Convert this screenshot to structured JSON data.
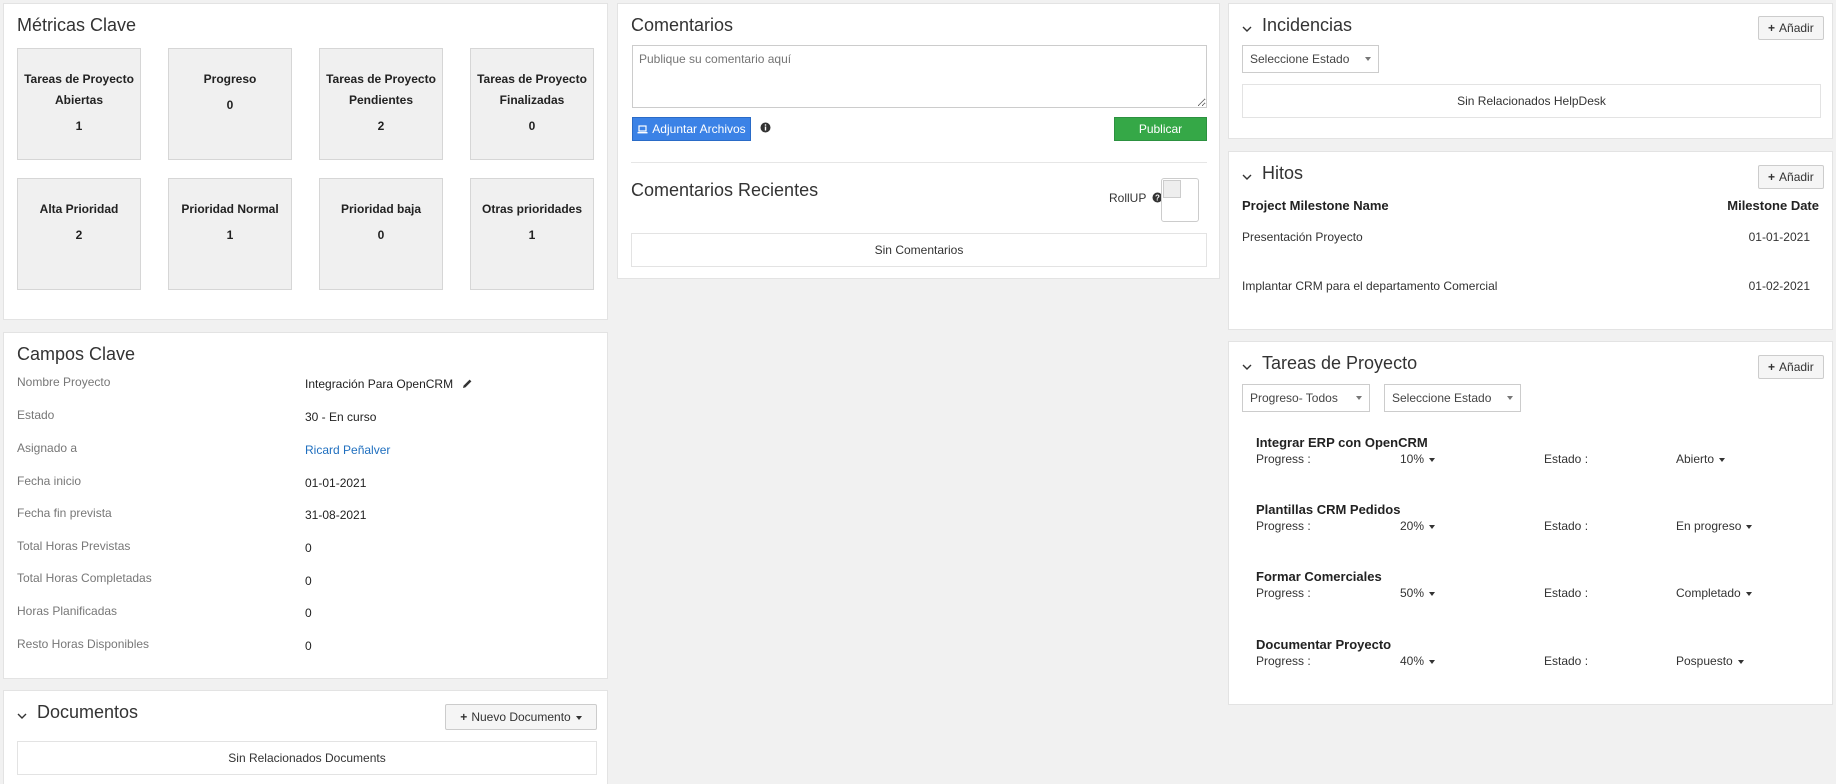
{
  "metrics": {
    "title": "Métricas Clave",
    "cards": [
      {
        "label": "Tareas de Proyecto Abiertas",
        "value": "1"
      },
      {
        "label": "Progreso",
        "value": "0"
      },
      {
        "label": "Tareas de Proyecto Pendientes",
        "value": "2"
      },
      {
        "label": "Tareas de Proyecto Finalizadas",
        "value": "0"
      },
      {
        "label": "Alta Prioridad",
        "value": "2"
      },
      {
        "label": "Prioridad Normal",
        "value": "1"
      },
      {
        "label": "Prioridad baja",
        "value": "0"
      },
      {
        "label": "Otras prioridades",
        "value": "1"
      }
    ]
  },
  "key_fields": {
    "title": "Campos Clave",
    "rows": [
      {
        "label": "Nombre Proyecto",
        "value": "Integración Para OpenCRM"
      },
      {
        "label": "Estado",
        "value": "30 - En curso"
      },
      {
        "label": "Asignado a",
        "value": "Ricard Peñalver"
      },
      {
        "label": "Fecha inicio",
        "value": "01-01-2021"
      },
      {
        "label": "Fecha fin prevista",
        "value": "31-08-2021"
      },
      {
        "label": "Total Horas Previstas",
        "value": "0"
      },
      {
        "label": "Total Horas Completadas",
        "value": "0"
      },
      {
        "label": "Horas Planificadas",
        "value": "0"
      },
      {
        "label": "Resto Horas Disponibles",
        "value": "0"
      }
    ]
  },
  "documents": {
    "title": "Documentos",
    "new_button": "Nuevo Documento",
    "empty": "Sin Relacionados Documents"
  },
  "comments": {
    "title": "Comentarios",
    "placeholder": "Publique su comentario aquí",
    "attach_button": "Adjuntar Archivos",
    "publish_button": "Publicar",
    "recent_title": "Comentarios Recientes",
    "rollup_label": "RollUP",
    "empty": "Sin Comentarios"
  },
  "incidents": {
    "title": "Incidencias",
    "add_label": "Añadir",
    "status_select": "Seleccione Estado",
    "empty": "Sin Relacionados HelpDesk"
  },
  "milestones": {
    "title": "Hitos",
    "add_label": "Añadir",
    "col_name": "Project Milestone Name",
    "col_date": "Milestone Date",
    "rows": [
      {
        "name": "Presentación Proyecto",
        "date": "01-01-2021"
      },
      {
        "name": "Implantar CRM para el departamento Comercial",
        "date": "01-02-2021"
      }
    ]
  },
  "tasks": {
    "title": "Tareas de Proyecto",
    "add_label": "Añadir",
    "progress_select": "Progreso- Todos",
    "status_select": "Seleccione Estado",
    "progress_label": "Progress :",
    "status_label": "Estado :",
    "items": [
      {
        "name": "Integrar ERP con OpenCRM",
        "progress": "10%",
        "status": "Abierto"
      },
      {
        "name": "Plantillas CRM Pedidos",
        "progress": "20%",
        "status": "En progreso"
      },
      {
        "name": "Formar Comerciales",
        "progress": "50%",
        "status": "Completado"
      },
      {
        "name": "Documentar Proyecto",
        "progress": "40%",
        "status": "Pospuesto"
      }
    ]
  },
  "colors": {
    "attach_blue": "#3b82e6",
    "publish_green": "#35a847",
    "link_blue": "#1f6fbf"
  }
}
